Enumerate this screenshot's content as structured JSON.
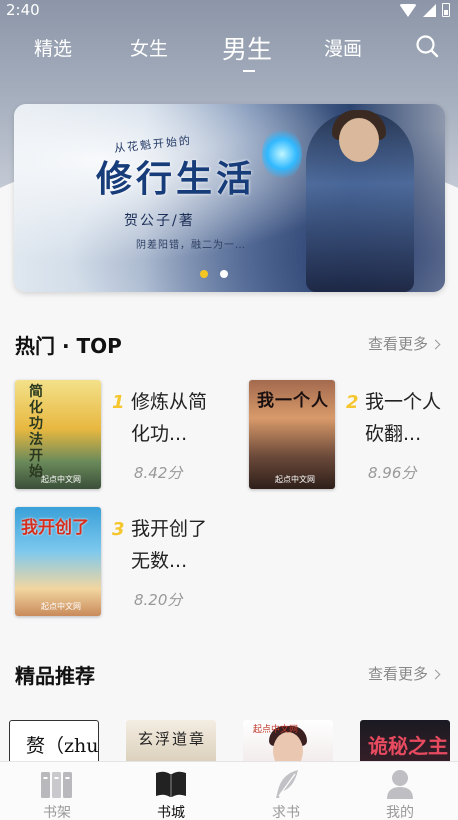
{
  "status_bar": {
    "time": "2:40"
  },
  "top_tabs": [
    {
      "label": "精选",
      "active": false
    },
    {
      "label": "女生",
      "active": false
    },
    {
      "label": "男生",
      "active": true
    },
    {
      "label": "漫画",
      "active": false
    }
  ],
  "banner": {
    "sub_title": "从花魁开始的",
    "title": "修行生活",
    "author": "贺公子/著",
    "tagline": "阴差阳错，融二为一…",
    "page_count": 2,
    "active_page": 1
  },
  "hot": {
    "title": "热门 · TOP",
    "more": "查看更多",
    "books": [
      {
        "rank": "1",
        "title": "修炼从简化功...",
        "score": "8.42分",
        "cover_text": "简化功法开始",
        "publisher": "起点中文网"
      },
      {
        "rank": "2",
        "title": "我一个人砍翻...",
        "score": "8.96分",
        "cover_text": "我一个人",
        "publisher": "起点中文网"
      },
      {
        "rank": "3",
        "title": "我开创了无数...",
        "score": "8.20分",
        "cover_text": "我开创了",
        "publisher": "起点中文网"
      }
    ]
  },
  "recommend": {
    "title": "精品推荐",
    "more": "查看更多",
    "covers": [
      {
        "text": "赘（zhui）"
      },
      {
        "text": "玄浮道章"
      },
      {
        "text": "起点中文网"
      },
      {
        "text": "诡秘之主"
      }
    ]
  },
  "bottom_nav": [
    {
      "label": "书架",
      "icon": "bookshelf-icon",
      "active": false
    },
    {
      "label": "书城",
      "icon": "book-open-icon",
      "active": true
    },
    {
      "label": "求书",
      "icon": "feather-icon",
      "active": false
    },
    {
      "label": "我的",
      "icon": "user-icon",
      "active": false
    }
  ],
  "colors": {
    "accent": "#f3c623",
    "rank": "#f5c62e",
    "muted": "#999999"
  }
}
